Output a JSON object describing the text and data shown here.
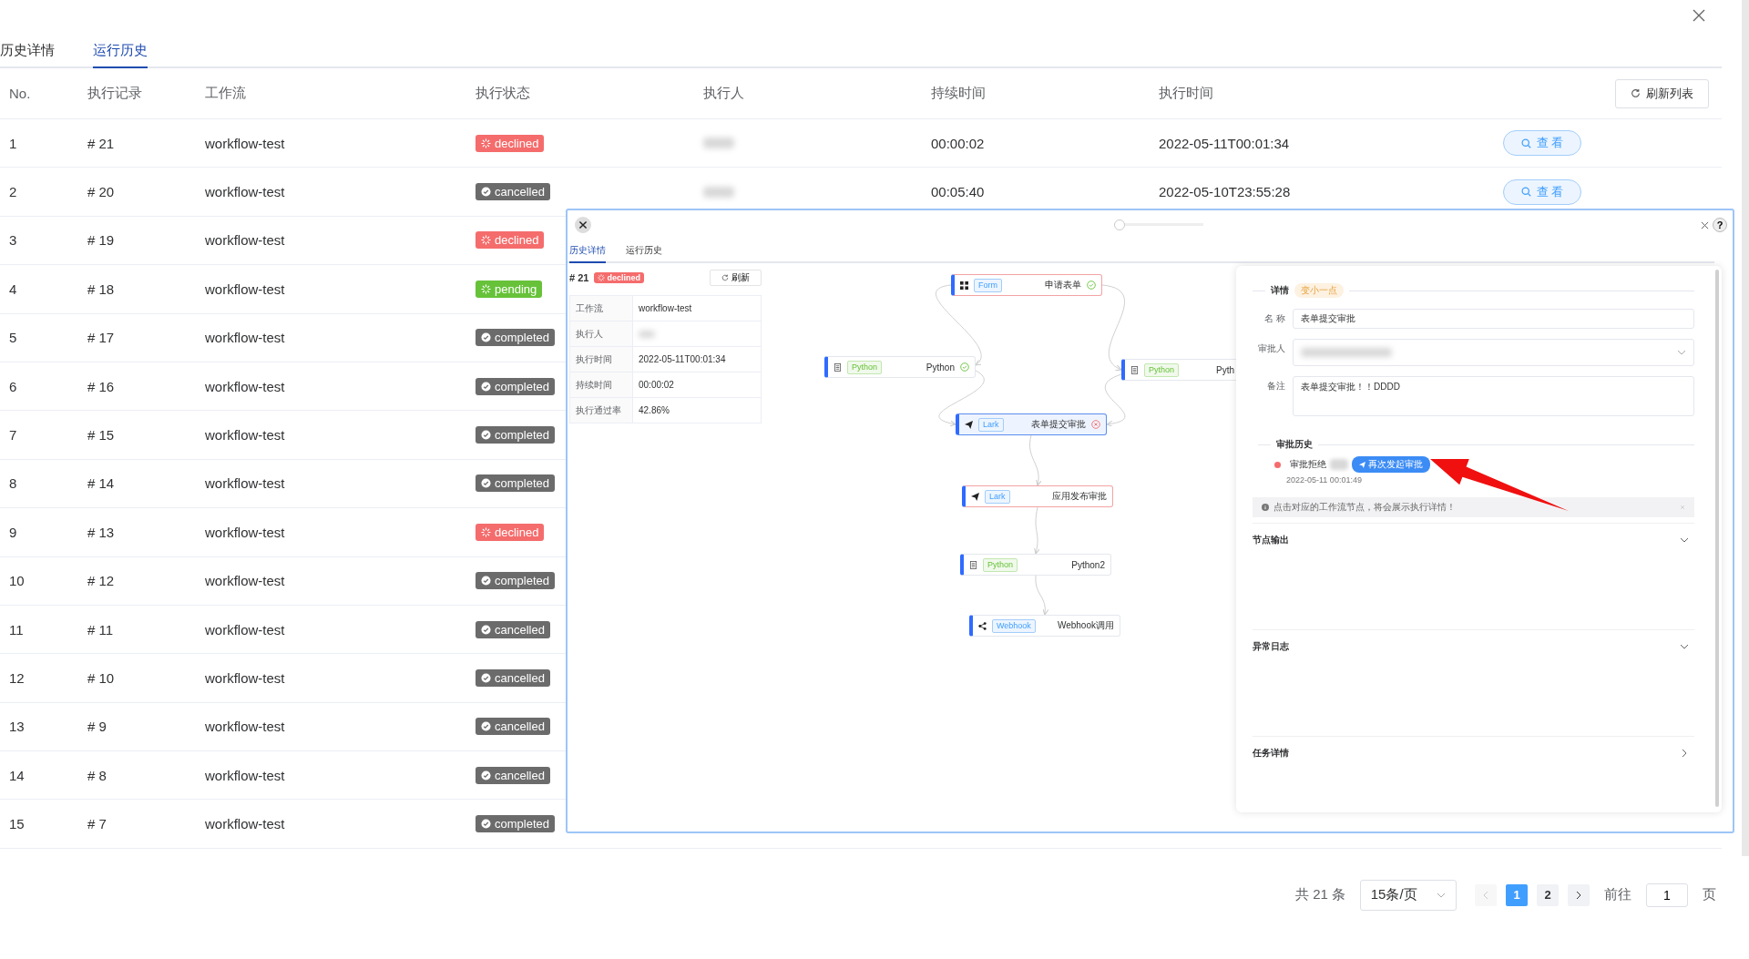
{
  "tabs": [
    {
      "label": "历史详情",
      "selected": false
    },
    {
      "label": "运行历史",
      "selected": true
    }
  ],
  "table": {
    "columns": [
      "No.",
      "执行记录",
      "工作流",
      "执行状态",
      "执行人",
      "持续时间",
      "执行时间"
    ],
    "refresh_button": "刷新列表",
    "rows": [
      {
        "no": "1",
        "record": "# 21",
        "workflow": "workflow-test",
        "status": {
          "label": "declined",
          "kind": "declined"
        },
        "executor_blurred": true,
        "duration": "00:00:02",
        "time": "2022-05-11T00:01:34",
        "action": "查 看"
      },
      {
        "no": "2",
        "record": "# 20",
        "workflow": "workflow-test",
        "status": {
          "label": "cancelled",
          "kind": "cancelled"
        },
        "executor_blurred": true,
        "duration": "00:05:40",
        "time": "2022-05-10T23:55:28",
        "action": "查 看"
      },
      {
        "no": "3",
        "record": "# 19",
        "workflow": "workflow-test",
        "status": {
          "label": "declined",
          "kind": "declined"
        }
      },
      {
        "no": "4",
        "record": "# 18",
        "workflow": "workflow-test",
        "status": {
          "label": "pending",
          "kind": "pending"
        }
      },
      {
        "no": "5",
        "record": "# 17",
        "workflow": "workflow-test",
        "status": {
          "label": "completed",
          "kind": "completed"
        }
      },
      {
        "no": "6",
        "record": "# 16",
        "workflow": "workflow-test",
        "status": {
          "label": "completed",
          "kind": "completed"
        }
      },
      {
        "no": "7",
        "record": "# 15",
        "workflow": "workflow-test",
        "status": {
          "label": "completed",
          "kind": "completed"
        }
      },
      {
        "no": "8",
        "record": "# 14",
        "workflow": "workflow-test",
        "status": {
          "label": "completed",
          "kind": "completed"
        }
      },
      {
        "no": "9",
        "record": "# 13",
        "workflow": "workflow-test",
        "status": {
          "label": "declined",
          "kind": "declined"
        }
      },
      {
        "no": "10",
        "record": "# 12",
        "workflow": "workflow-test",
        "status": {
          "label": "completed",
          "kind": "completed"
        }
      },
      {
        "no": "11",
        "record": "# 11",
        "workflow": "workflow-test",
        "status": {
          "label": "cancelled",
          "kind": "cancelled"
        }
      },
      {
        "no": "12",
        "record": "# 10",
        "workflow": "workflow-test",
        "status": {
          "label": "cancelled",
          "kind": "cancelled"
        }
      },
      {
        "no": "13",
        "record": "# 9",
        "workflow": "workflow-test",
        "status": {
          "label": "cancelled",
          "kind": "cancelled"
        }
      },
      {
        "no": "14",
        "record": "# 8",
        "workflow": "workflow-test",
        "status": {
          "label": "cancelled",
          "kind": "cancelled"
        }
      },
      {
        "no": "15",
        "record": "# 7",
        "workflow": "workflow-test",
        "status": {
          "label": "completed",
          "kind": "completed"
        }
      }
    ]
  },
  "pagination": {
    "total": "共 21 条",
    "page_size": "15条/页",
    "prev_disabled": true,
    "pages": [
      {
        "label": "1",
        "selected": true
      },
      {
        "label": "2",
        "selected": false
      }
    ],
    "goto_label": "前往",
    "goto_value": "1",
    "goto_suffix": "页"
  },
  "popup": {
    "zoom_slider": {
      "level": 0
    },
    "help_button": "?",
    "tabs": [
      {
        "label": "历史详情",
        "selected": true
      },
      {
        "label": "运行历史",
        "selected": false
      }
    ],
    "run": {
      "number": "# 21",
      "status": {
        "label": "declined",
        "kind": "declined"
      },
      "refresh_button": "刷新",
      "info": [
        {
          "label": "工作流",
          "value": "workflow-test"
        },
        {
          "label": "执行人",
          "blurred": true
        },
        {
          "label": "执行时间",
          "value": "2022-05-11T00:01:34"
        },
        {
          "label": "持续时间",
          "value": "00:00:02"
        },
        {
          "label": "执行通过率",
          "value": "42.86%"
        }
      ]
    },
    "nodes": [
      {
        "kind": "form",
        "tag": "Form",
        "name": "申请表单",
        "selected": false,
        "error": true,
        "passed": true,
        "rejected": false
      },
      {
        "kind": "python",
        "tag": "Python",
        "name": "Python",
        "selected": false,
        "error": false,
        "passed": true,
        "rejected": false
      },
      {
        "kind": "python",
        "tag": "Python",
        "name": "Pyth",
        "selected": false,
        "error": false,
        "passed": false,
        "rejected": false
      },
      {
        "kind": "lark",
        "tag": "Lark",
        "name": "表单提交审批",
        "selected": true,
        "error": false,
        "passed": false,
        "rejected": true
      },
      {
        "kind": "lark",
        "tag": "Lark",
        "name": "应用发布审批",
        "selected": false,
        "error": true,
        "passed": false,
        "rejected": false
      },
      {
        "kind": "python",
        "tag": "Python",
        "name": "Python2",
        "selected": false,
        "error": false,
        "passed": false,
        "rejected": false
      },
      {
        "kind": "webhook",
        "tag": "Webhook",
        "name": "Webhook调用",
        "selected": false,
        "error": false,
        "passed": false,
        "rejected": false
      }
    ],
    "detail": {
      "title": "详情",
      "size_tag": "变小一点",
      "fields": [
        {
          "label": "名 称",
          "kind": "text",
          "value": "表单提交审批"
        },
        {
          "label": "审批人",
          "kind": "select",
          "blurred": true
        },
        {
          "label": "备注",
          "kind": "textarea",
          "value": "表单提交审批！！DDDD"
        }
      ],
      "history_title": "审批历史",
      "history": [
        {
          "color": "#f56c6c",
          "text": "审批拒绝",
          "name_blurred": true,
          "action": "再次发起审批",
          "time": "2022-05-11 00:01:49"
        }
      ],
      "tip": "点击对应的工作流节点，将会展示执行详情！",
      "sections": [
        {
          "title": "节点输出",
          "expanded": true
        },
        {
          "title": "异常日志",
          "expanded": true
        },
        {
          "title": "任务详情",
          "expanded": false
        }
      ]
    }
  }
}
